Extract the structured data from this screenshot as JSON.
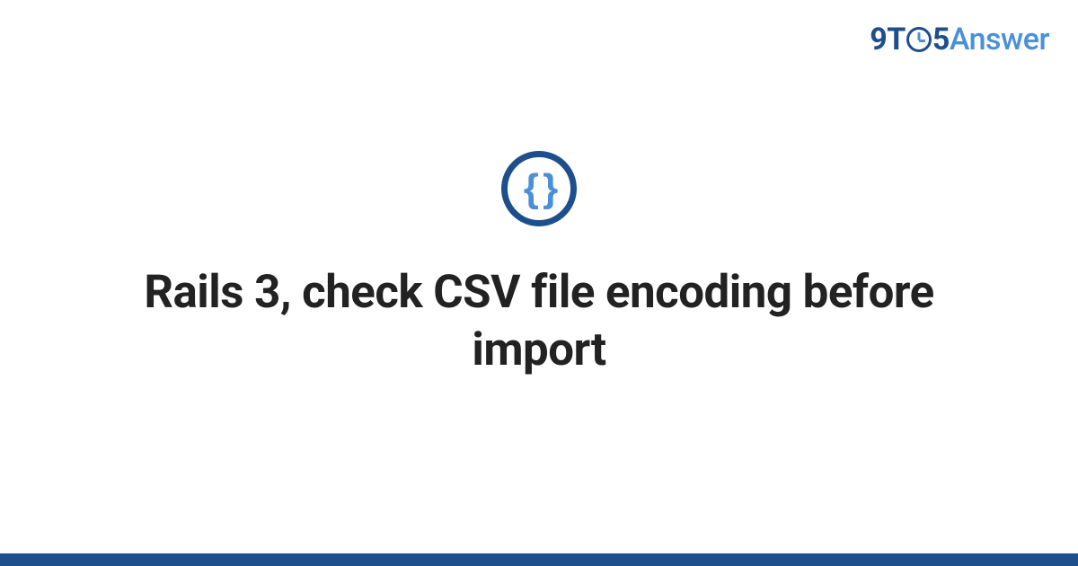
{
  "brand": {
    "prefix": "9T",
    "mid": "5",
    "suffix": "Answer"
  },
  "category": {
    "icon_label": "{ }"
  },
  "question": {
    "title": "Rails 3, check CSV file encoding before import"
  }
}
